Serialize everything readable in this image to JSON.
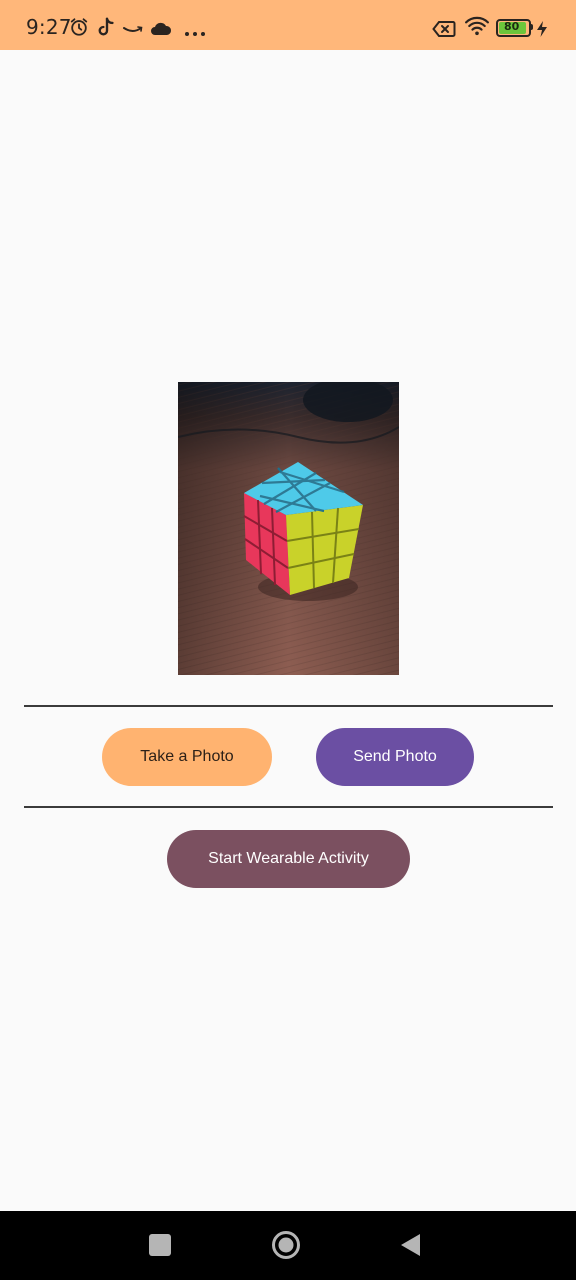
{
  "status_bar": {
    "time": "9:27",
    "battery_level": "80",
    "background_color": "#ffb77a",
    "icons_left": [
      "alarm-icon",
      "tiktok-icon",
      "amazon-icon",
      "cloud-icon",
      "more-notifications-icon"
    ],
    "icons_right": [
      "no-sim-icon",
      "wifi-icon",
      "battery-icon",
      "charging-icon"
    ]
  },
  "photo": {
    "description_icon": "rubiks-cube-photo"
  },
  "buttons": {
    "take_photo": "Take a Photo",
    "send_photo": "Send Photo",
    "start_wearable": "Start Wearable Activity"
  },
  "colors": {
    "take_photo_bg": "#ffb370",
    "send_photo_bg": "#6b4fa3",
    "start_wearable_bg": "#7b5060"
  },
  "nav_bar": {
    "items": [
      "recents-button",
      "home-button",
      "back-button"
    ]
  }
}
